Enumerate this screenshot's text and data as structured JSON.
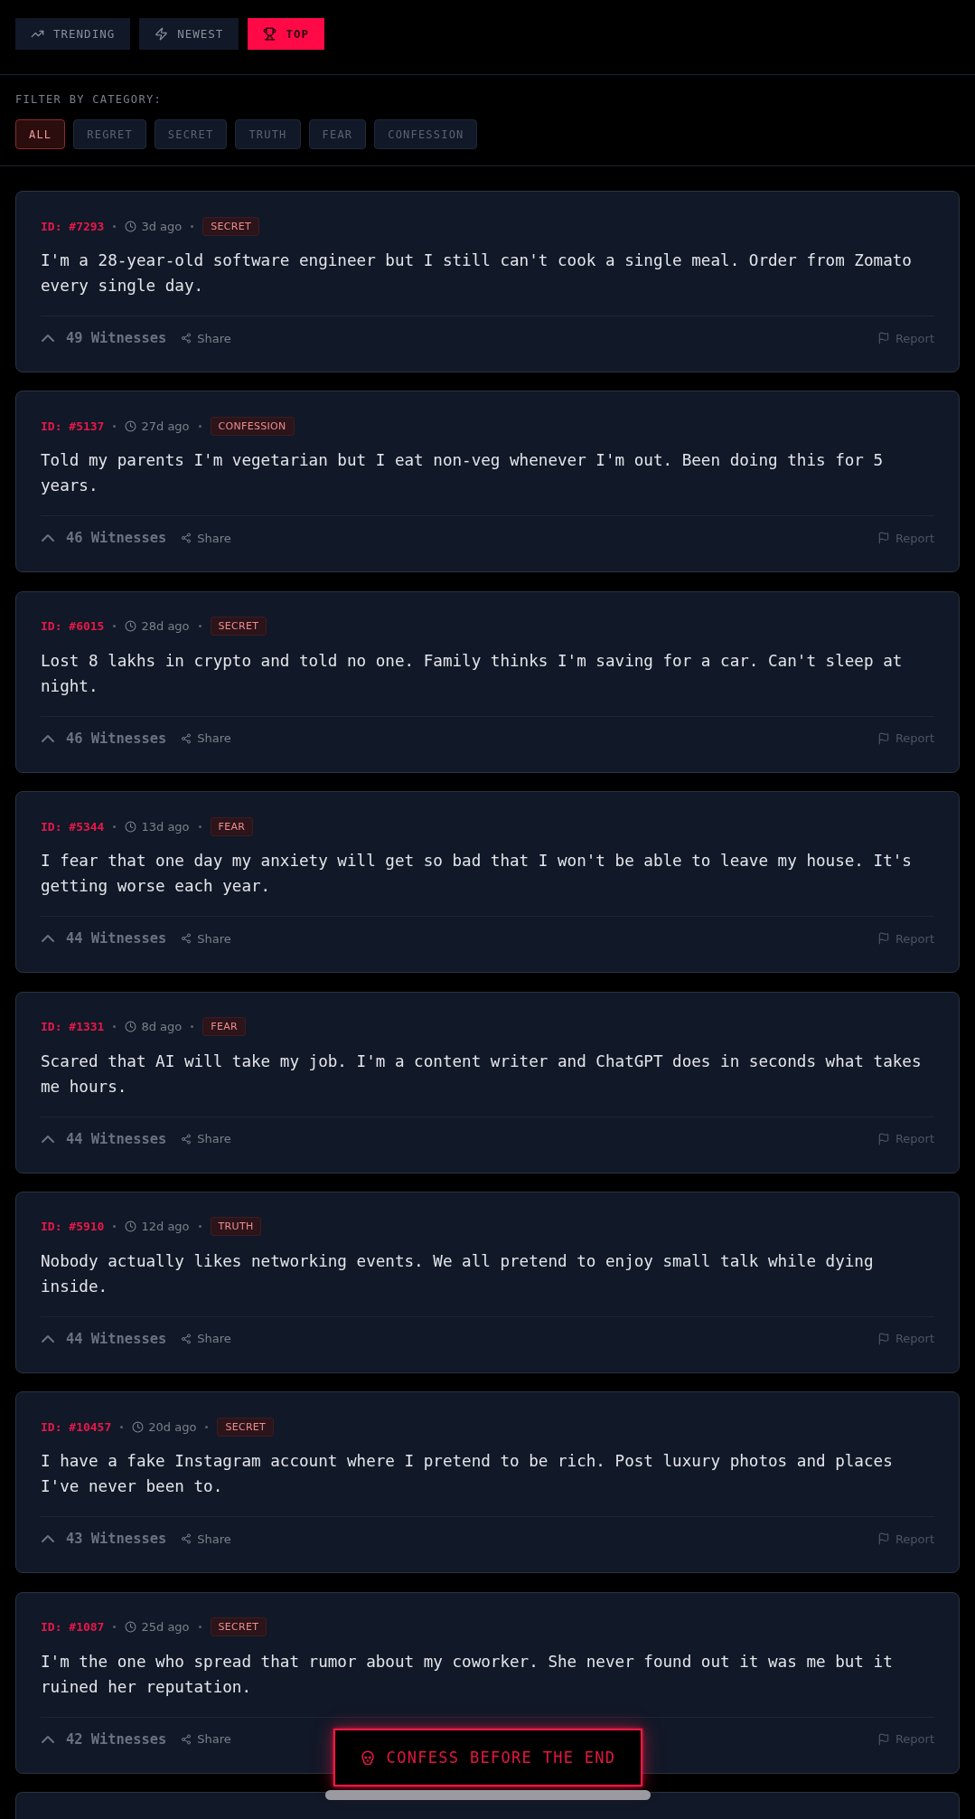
{
  "sort_tabs": [
    {
      "label": "TRENDING",
      "selected": false
    },
    {
      "label": "NEWEST",
      "selected": false
    },
    {
      "label": "TOP",
      "selected": true
    }
  ],
  "filter": {
    "label": "FILTER BY CATEGORY:",
    "categories": [
      {
        "label": "ALL",
        "selected": true
      },
      {
        "label": "REGRET",
        "selected": false
      },
      {
        "label": "SECRET",
        "selected": false
      },
      {
        "label": "TRUTH",
        "selected": false
      },
      {
        "label": "FEAR",
        "selected": false
      },
      {
        "label": "CONFESSION",
        "selected": false
      }
    ]
  },
  "posts": [
    {
      "id": "ID: #7293",
      "time": "3d ago",
      "tag": "SECRET",
      "text": "I'm a 28-year-old software engineer but I still can't cook a single meal. Order from Zomato every single day.",
      "witnesses": "49 Witnesses",
      "share": "Share",
      "report": "Report"
    },
    {
      "id": "ID: #5137",
      "time": "27d ago",
      "tag": "CONFESSION",
      "text": "Told my parents I'm vegetarian but I eat non-veg whenever I'm out. Been doing this for 5 years.",
      "witnesses": "46 Witnesses",
      "share": "Share",
      "report": "Report"
    },
    {
      "id": "ID: #6015",
      "time": "28d ago",
      "tag": "SECRET",
      "text": "Lost 8 lakhs in crypto and told no one. Family thinks I'm saving for a car. Can't sleep at night.",
      "witnesses": "46 Witnesses",
      "share": "Share",
      "report": "Report"
    },
    {
      "id": "ID: #5344",
      "time": "13d ago",
      "tag": "FEAR",
      "text": "I fear that one day my anxiety will get so bad that I won't be able to leave my house. It's getting worse each year.",
      "witnesses": "44 Witnesses",
      "share": "Share",
      "report": "Report"
    },
    {
      "id": "ID: #1331",
      "time": "8d ago",
      "tag": "FEAR",
      "text": "Scared that AI will take my job. I'm a content writer and ChatGPT does in seconds what takes me hours.",
      "witnesses": "44 Witnesses",
      "share": "Share",
      "report": "Report"
    },
    {
      "id": "ID: #5910",
      "time": "12d ago",
      "tag": "TRUTH",
      "text": "Nobody actually likes networking events. We all pretend to enjoy small talk while dying inside.",
      "witnesses": "44 Witnesses",
      "share": "Share",
      "report": "Report"
    },
    {
      "id": "ID: #10457",
      "time": "20d ago",
      "tag": "SECRET",
      "text": "I have a fake Instagram account where I pretend to be rich. Post luxury photos and places I've never been to.",
      "witnesses": "43 Witnesses",
      "share": "Share",
      "report": "Report"
    },
    {
      "id": "ID: #1087",
      "time": "25d ago",
      "tag": "SECRET",
      "text": "I'm the one who spread that rumor about my coworker. She never found out it was me but it ruined her reputation.",
      "witnesses": "42 Witnesses",
      "share": "Share",
      "report": "Report"
    }
  ],
  "confess_button": {
    "label": "CONFESS BEFORE THE END"
  }
}
